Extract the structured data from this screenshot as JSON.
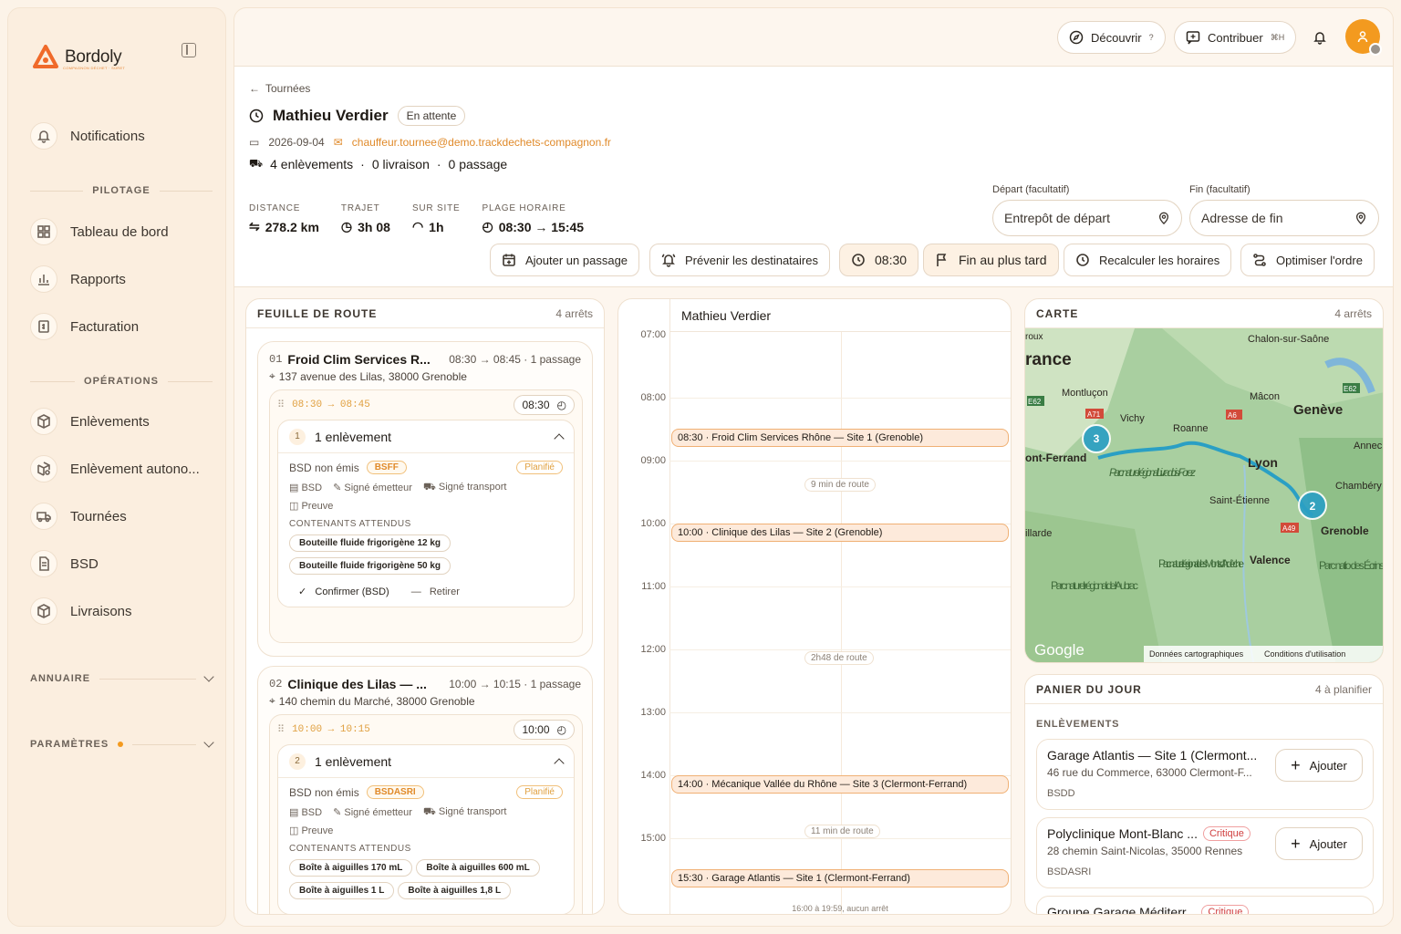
{
  "sidebar": {
    "brand": "Bordoly",
    "tagline": "COMPAGNON DÉCHET · SÛRET",
    "notifications": "Notifications",
    "pilotage_label": "PILOTAGE",
    "pilotage": [
      "Tableau de bord",
      "Rapports",
      "Facturation"
    ],
    "operations_label": "OPÉRATIONS",
    "operations": [
      "Enlèvements",
      "Enlèvement autono...",
      "Tournées",
      "BSD",
      "Livraisons"
    ],
    "annuaire_label": "ANNUAIRE",
    "parametres_label": "PARAMÈTRES"
  },
  "topbar": {
    "discover": "Découvrir",
    "discover_kbd": "?",
    "contribute": "Contribuer",
    "contribute_kbd": "⌘H"
  },
  "header": {
    "breadcrumb": "Tournées",
    "driver": "Mathieu Verdier",
    "status": "En attente",
    "date": "2026-09-04",
    "email": "chauffeur.tournee@demo.trackdechets-compagnon.fr",
    "pickups": "4 enlèvements",
    "deliveries": "0 livraison",
    "passages": "0 passage",
    "stats": [
      {
        "label": "DISTANCE",
        "value": "278.2 km"
      },
      {
        "label": "TRAJET",
        "value": "3h 08"
      },
      {
        "label": "SUR SITE",
        "value": "1h"
      },
      {
        "label": "PLAGE HORAIRE",
        "value": "08:30 → 15:45"
      }
    ],
    "start_label": "Départ (facultatif)",
    "start_placeholder": "Entrepôt de départ",
    "end_label": "Fin (facultatif)",
    "end_placeholder": "Adresse de fin",
    "actions": {
      "add": "Ajouter un passage",
      "notify": "Prévenir les destinataires",
      "time": "08:30",
      "latest": "Fin au plus tard",
      "recalc": "Recalculer les horaires",
      "optimize": "Optimiser l'ordre"
    }
  },
  "roadsheet": {
    "title": "FEUILLE DE ROUTE",
    "count": "4 arrêts",
    "stops": [
      {
        "num": "01",
        "name": "Froid Clim Services R...",
        "time": "08:30 → 08:45 · 1 passage",
        "address": "137 avenue des Lilas, 38000 Grenoble",
        "window": "08:30 → 08:45",
        "eta": "08:30",
        "pick_num": "1",
        "pick_title": "1 enlèvement",
        "bsd": "BSD non émis",
        "type": "BSFF",
        "state": "Planifié",
        "sig": [
          "BSD",
          "Signé émetteur",
          "Signé transport"
        ],
        "proof": "Preuve",
        "containers_label": "CONTENANTS ATTENDUS",
        "containers": [
          "Bouteille fluide frigorigène 12 kg",
          "Bouteille fluide frigorigène 50 kg"
        ],
        "confirm": "Confirmer (BSD)",
        "remove": "Retirer"
      },
      {
        "num": "02",
        "name": "Clinique des Lilas — ...",
        "time": "10:00 → 10:15 · 1 passage",
        "address": "140 chemin du Marché, 38000 Grenoble",
        "window": "10:00 → 10:15",
        "eta": "10:00",
        "pick_num": "2",
        "pick_title": "1 enlèvement",
        "bsd": "BSD non émis",
        "type": "BSDASRI",
        "state": "Planifié",
        "sig": [
          "BSD",
          "Signé émetteur",
          "Signé transport"
        ],
        "proof": "Preuve",
        "containers_label": "CONTENANTS ATTENDUS",
        "containers": [
          "Boîte à aiguilles 170 mL",
          "Boîte à aiguilles 600 mL",
          "Boîte à aiguilles 1 L",
          "Boîte à aiguilles 1,8 L"
        ]
      }
    ]
  },
  "calendar": {
    "driver": "Mathieu Verdier",
    "hours": [
      "07:00",
      "08:00",
      "09:00",
      "10:00",
      "11:00",
      "12:00",
      "13:00",
      "14:00",
      "15:00"
    ],
    "events": [
      "08:30 · Froid Clim Services Rhône — Site 1 (Grenoble)",
      "10:00 · Clinique des Lilas — Site 2 (Grenoble)",
      "14:00 · Mécanique Vallée du Rhône — Site 3 (Clermont-Ferrand)",
      "15:30 · Garage Atlantis — Site 1 (Clermont-Ferrand)"
    ],
    "gaps": [
      "9 min de route",
      "2h48 de route",
      "11 min de route"
    ],
    "footer": "16:00 à 19:59, aucun arrêt"
  },
  "map": {
    "title": "CARTE",
    "count": "4 arrêts",
    "labels": [
      "Chalon-sur-Saône",
      "rance",
      "Montluçon",
      "Mâcon",
      "Genève",
      "Vichy",
      "Roanne",
      "Annec",
      "ont-Ferrand",
      "Lyon",
      "Chambéry",
      "Parc naturel régional Livradois-Forez",
      "Saint-Étienne",
      "illarde",
      "Grenoble",
      "Valence",
      "Parc naturel régional des Monts d'Ardèche",
      "Parc naturel régional de l'Aubrac",
      "Parc natio des Écrins",
      "roux"
    ],
    "roads": [
      "A71",
      "E62",
      "A6",
      "E62",
      "A49"
    ],
    "clusters": [
      "3",
      "2"
    ],
    "google": "Google",
    "attrib": [
      "Données cartographiques",
      "Conditions d'utilisation"
    ]
  },
  "basket": {
    "title": "PANIER DU JOUR",
    "count": "4 à planifier",
    "section": "ENLÈVEMENTS",
    "add": "Ajouter",
    "items": [
      {
        "name": "Garage Atlantis — Site 1 (Clermont...",
        "address": "46 rue du Commerce, 63000 Clermont-F...",
        "type": "BSDD",
        "critical": ""
      },
      {
        "name": "Polyclinique Mont-Blanc ...",
        "address": "28 chemin Saint-Nicolas, 35000 Rennes",
        "type": "BSDASRI",
        "critical": "Critique"
      },
      {
        "name": "Groupe Garage Méditerr...",
        "address": "",
        "type": "",
        "critical": "Critique"
      }
    ]
  },
  "colors": {
    "accent": "#f39a1f",
    "event_border": "#f0b074",
    "route": "#2a9fc4"
  }
}
